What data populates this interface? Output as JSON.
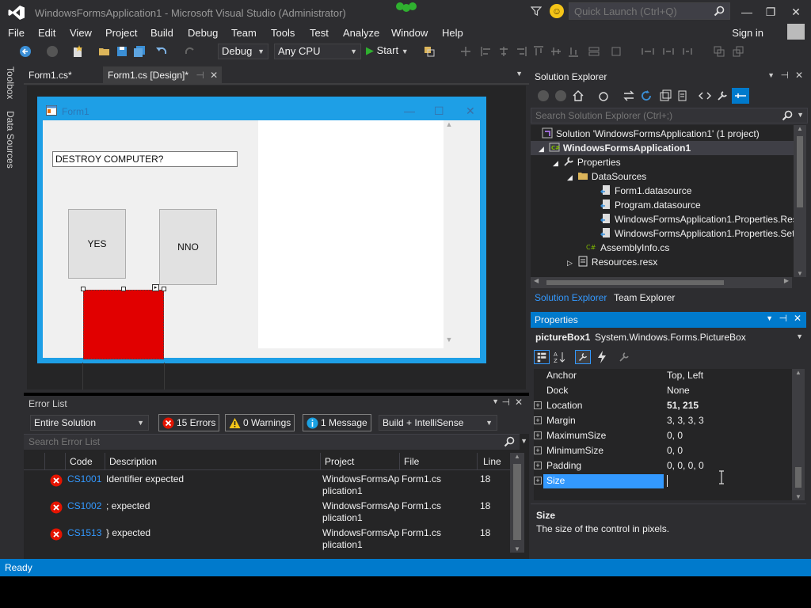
{
  "window": {
    "title": "WindowsFormsApplication1 - Microsoft Visual Studio (Administrator)",
    "quick_launch_placeholder": "Quick Launch (Ctrl+Q)",
    "sign_in": "Sign in"
  },
  "menu": [
    "File",
    "Edit",
    "View",
    "Project",
    "Build",
    "Debug",
    "Team",
    "Tools",
    "Test",
    "Analyze",
    "Window",
    "Help"
  ],
  "toolbar": {
    "config": "Debug",
    "platform": "Any CPU",
    "start": "Start"
  },
  "left_strip": {
    "toolbox": "Toolbox",
    "data_sources": "Data Sources"
  },
  "doc_tabs": [
    {
      "label": "Form1.cs*"
    },
    {
      "label": "Form1.cs [Design]*"
    }
  ],
  "form": {
    "title": "Form1",
    "textbox": "DESTROY COMPUTER?",
    "btn_yes": "YES",
    "btn_no": "NNO"
  },
  "error_list": {
    "title": "Error List",
    "scope": "Entire Solution",
    "errors": "15 Errors",
    "warnings": "0 Warnings",
    "messages": "1 Message",
    "build_filter": "Build + IntelliSense",
    "search_placeholder": "Search Error List",
    "columns": [
      "Code",
      "Description",
      "Project",
      "File",
      "Line"
    ],
    "rows": [
      {
        "code": "CS1001",
        "desc": "Identifier expected",
        "project": "WindowsFormsApplication1",
        "file": "Form1.cs",
        "line": "18"
      },
      {
        "code": "CS1002",
        "desc": "; expected",
        "project": "WindowsFormsApplication1",
        "file": "Form1.cs",
        "line": "18"
      },
      {
        "code": "CS1513",
        "desc": "} expected",
        "project": "WindowsFormsApplication1",
        "file": "Form1.cs",
        "line": "18"
      }
    ]
  },
  "solution_explorer": {
    "title": "Solution Explorer",
    "search_placeholder": "Search Solution Explorer (Ctrl+;)",
    "tree": [
      {
        "label": "Solution 'WindowsFormsApplication1' (1 project)",
        "bold": false
      },
      {
        "label": "WindowsFormsApplication1",
        "bold": true
      },
      {
        "label": "Properties",
        "bold": false
      },
      {
        "label": "DataSources",
        "bold": false
      },
      {
        "label": "Form1.datasource",
        "bold": false
      },
      {
        "label": "Program.datasource",
        "bold": false
      },
      {
        "label": "WindowsFormsApplication1.Properties.Res",
        "bold": false
      },
      {
        "label": "WindowsFormsApplication1.Properties.Set",
        "bold": false
      },
      {
        "label": "AssemblyInfo.cs",
        "bold": false
      },
      {
        "label": "Resources.resx",
        "bold": false
      }
    ],
    "tab_active": "Solution Explorer",
    "tab_other": "Team Explorer"
  },
  "properties": {
    "title": "Properties",
    "object_name": "pictureBox1",
    "object_type": "System.Windows.Forms.PictureBox",
    "rows": [
      {
        "name": "Anchor",
        "value": "Top, Left",
        "expandable": false,
        "bold": false
      },
      {
        "name": "Dock",
        "value": "None",
        "expandable": false,
        "bold": false
      },
      {
        "name": "Location",
        "value": "51, 215",
        "expandable": true,
        "bold": true
      },
      {
        "name": "Margin",
        "value": "3, 3, 3, 3",
        "expandable": true,
        "bold": false
      },
      {
        "name": "MaximumSize",
        "value": "0, 0",
        "expandable": true,
        "bold": false
      },
      {
        "name": "MinimumSize",
        "value": "0, 0",
        "expandable": true,
        "bold": false
      },
      {
        "name": "Padding",
        "value": "0, 0, 0, 0",
        "expandable": true,
        "bold": false
      },
      {
        "name": "Size",
        "value": "",
        "expandable": true,
        "bold": false
      }
    ],
    "desc_title": "Size",
    "desc_text": "The size of the control in pixels."
  },
  "status": {
    "text": "Ready"
  },
  "colors": {
    "accent": "#007acc",
    "chrome": "#2d2d30",
    "form_border": "#1e9fe6",
    "picture_fill": "#e10000",
    "error_red": "#e51400",
    "warning_yellow": "#f5c518"
  }
}
